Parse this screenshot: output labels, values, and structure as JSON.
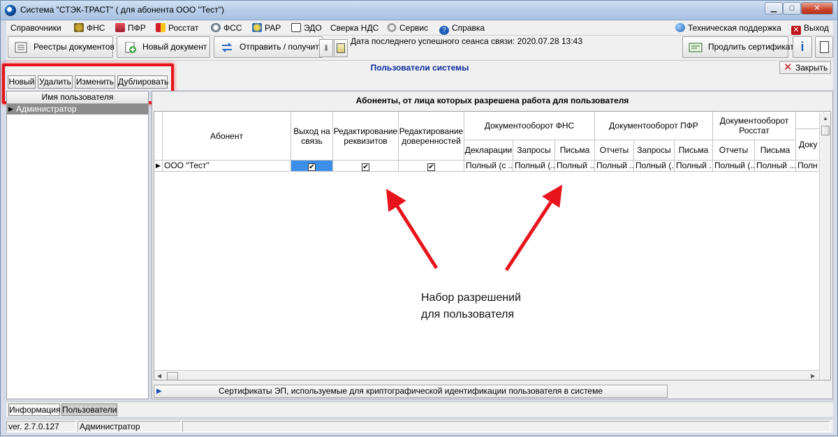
{
  "window": {
    "title": "Система \"СТЭК-ТРАСТ\" ( для абонента ООО \"Тест\")",
    "minimize": "▁",
    "maximize": "□",
    "close": "✕"
  },
  "menu": {
    "items": [
      {
        "label": "Справочники",
        "icon": ""
      },
      {
        "label": "ФНС",
        "icon": "fns-icon"
      },
      {
        "label": "ПФР",
        "icon": "pfr-icon"
      },
      {
        "label": "Росстат",
        "icon": "rosstat-icon"
      },
      {
        "label": "ФСС",
        "icon": "fss-icon"
      },
      {
        "label": "РАР",
        "icon": "rar-icon"
      },
      {
        "label": "ЭДО",
        "icon": "edo-icon"
      },
      {
        "label": "Сверка НДС",
        "icon": ""
      },
      {
        "label": "Сервис",
        "icon": "gear-icon"
      },
      {
        "label": "Справка",
        "icon": "help-icon"
      }
    ],
    "support": "Техническая поддержка",
    "exit": "Выход"
  },
  "toolbar": {
    "registries": "Реестры документов",
    "new_document": "Новый документ",
    "send_receive": "Отправить / получить",
    "session_label": "Дата последнего успешного сеанса связи: 2020.07.28 13:43",
    "extend_cert": "Продлить сертификат",
    "info": "i"
  },
  "form": {
    "title": "Пользователи системы",
    "close": "Закрыть"
  },
  "actions": {
    "new": "Новый",
    "delete": "Удалить",
    "edit": "Изменить",
    "duplicate": "Дублировать"
  },
  "users": {
    "header": "Имя пользователя",
    "rows": [
      "Администратор"
    ]
  },
  "permissions": {
    "title": "Абоненты, от лица которых разрешена работа для пользователя",
    "headers": {
      "subscriber": "Абонент",
      "exit_link": "Выход на связь",
      "edit_requisites": "Редактирование реквизитов",
      "edit_power": "Редактирование доверенностей",
      "fns_group": "Документооборот ФНС",
      "fns_decl": "Декларации",
      "fns_req": "Запросы",
      "fns_letters": "Письма",
      "pfr_group": "Документооборот ПФР",
      "pfr_reports": "Отчеты",
      "pfr_req": "Запросы",
      "pfr_letters": "Письма",
      "rosstat_group": "Документооборот Росстат",
      "rosstat_reports": "Отчеты",
      "rosstat_letters": "Письма",
      "next_partial": "Доку"
    },
    "row": {
      "subscriber": "ООО \"Тест\"",
      "exit_link": true,
      "edit_requisites": true,
      "edit_power": true,
      "fns_decl": "Полный (с ...",
      "fns_req": "Полный (...",
      "fns_letters": "Полный ...",
      "pfr_reports": "Полный ...",
      "pfr_req": "Полный (...",
      "pfr_letters": "Полный ...",
      "rosstat_reports": "Полный (...",
      "rosstat_letters": "Полный ...",
      "next_partial": "Полн"
    },
    "checkmark": "✔",
    "cert_bar": "Сертификаты ЭП, используемые для криптографической идентификации пользователя в системе"
  },
  "annotation": {
    "line1": "Набор разрешений",
    "line2": "для пользователя",
    "color": "#e8141b"
  },
  "tabs": [
    "Информация",
    "Пользователи"
  ],
  "status": {
    "version": "ver. 2.7.0.127",
    "user": "Администратор"
  }
}
